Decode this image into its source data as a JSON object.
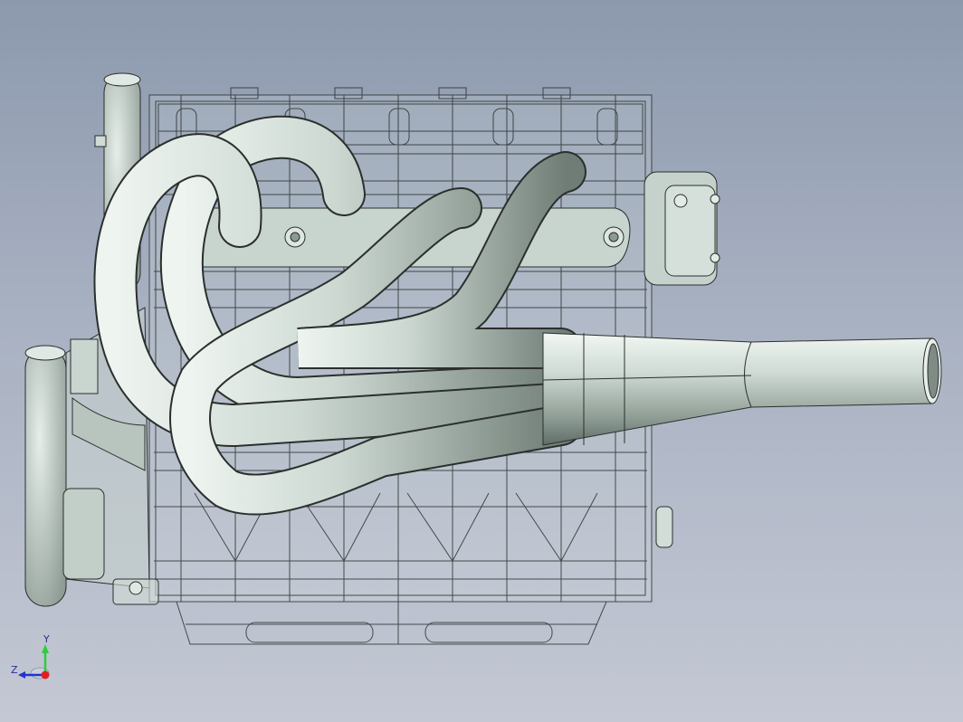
{
  "viewport": {
    "background_top": "#8c99ad",
    "background_bottom": "#c4c8d4",
    "model_color": "#c9d6cf",
    "edge_color": "#2b2f2d"
  },
  "triad": {
    "y_label": "Y",
    "z_label": "Z",
    "y_axis_color": "#2ecc40",
    "z_axis_color": "#2233cc",
    "x_axis_color": "#e02020"
  }
}
